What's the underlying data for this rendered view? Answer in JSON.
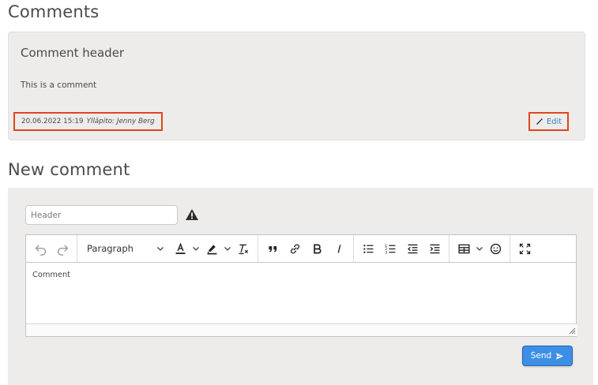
{
  "comments_section": {
    "title": "Comments"
  },
  "comment": {
    "header": "Comment header",
    "body": "This is a comment",
    "timestamp": "20.06.2022 15:19",
    "author": "Ylläpito: Jenny Berg",
    "edit_label": "Edit"
  },
  "new_comment": {
    "title": "New comment",
    "header_placeholder": "Header",
    "editor": {
      "paragraph_label": "Paragraph",
      "body_placeholder": "Comment"
    },
    "send_label": "Send"
  },
  "colors": {
    "highlight_border": "#e0451d",
    "link": "#3c7fbf",
    "primary": "#3d8fe6",
    "card_bg": "#edecea"
  }
}
